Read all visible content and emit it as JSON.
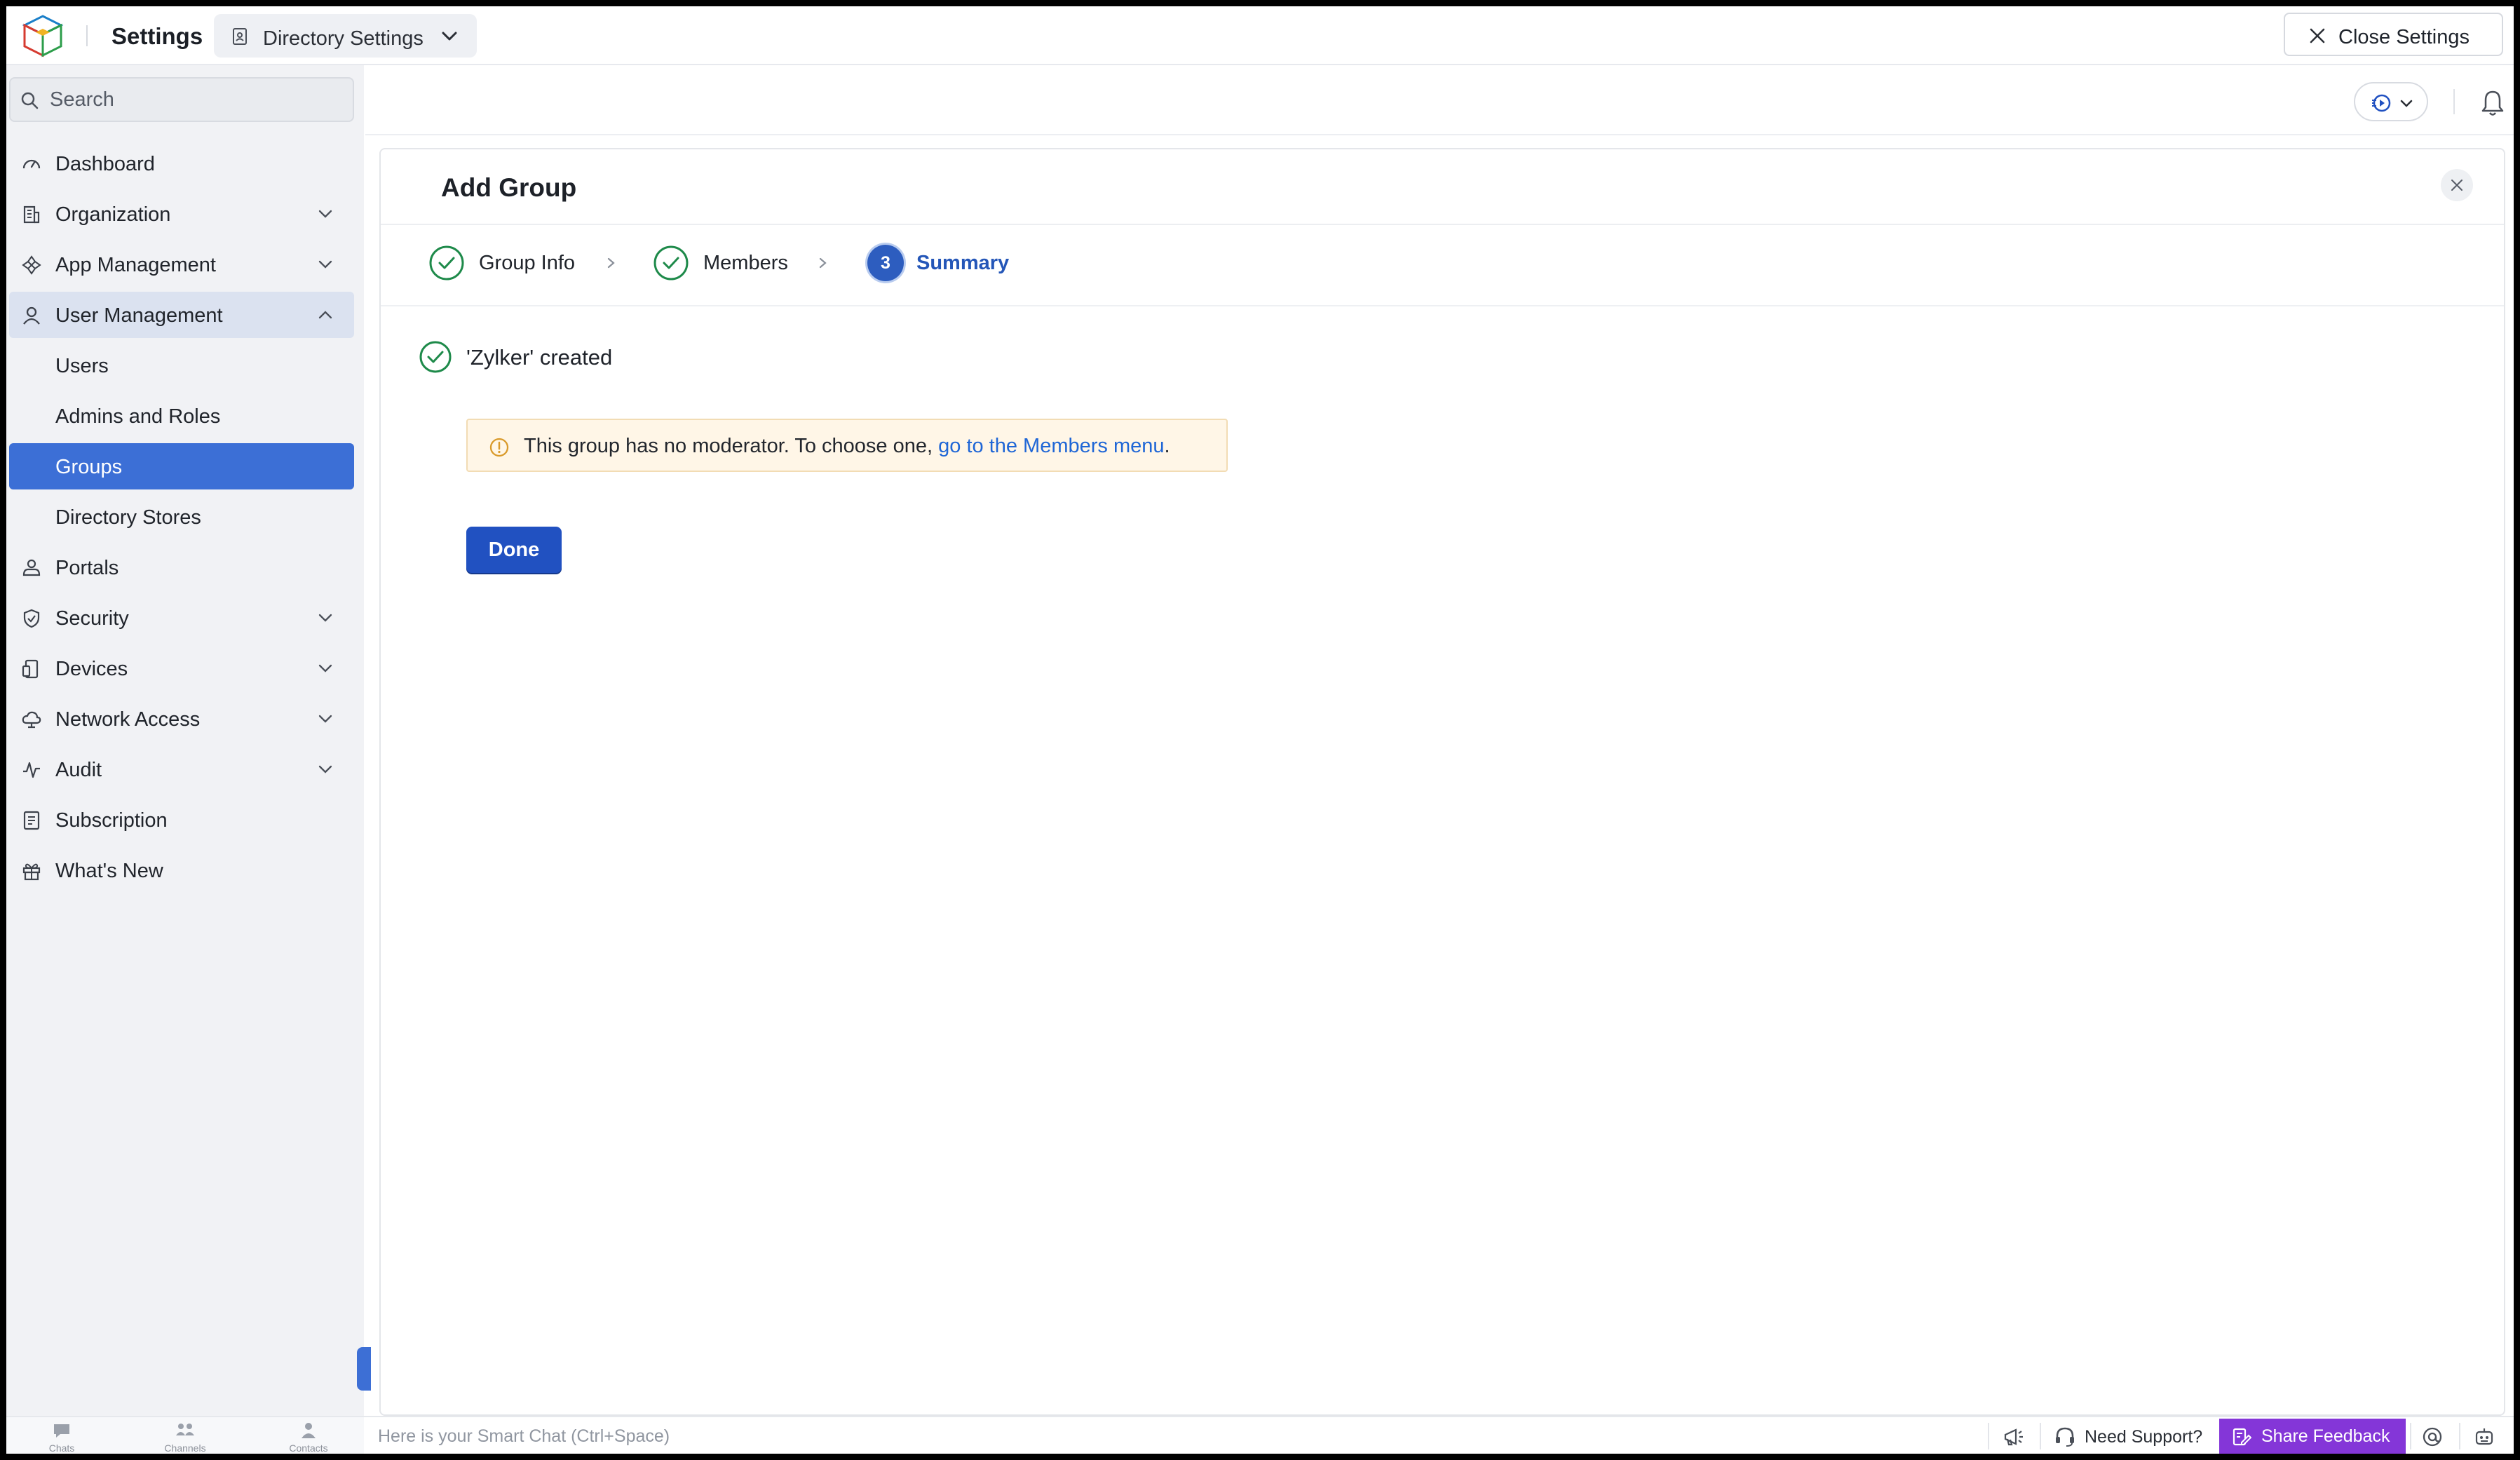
{
  "topbar": {
    "title": "Settings",
    "directory_dropdown": "Directory Settings",
    "close_settings": "Close Settings"
  },
  "sidebar": {
    "search_placeholder": "Search",
    "items": [
      {
        "label": "Dashboard",
        "icon": "dashboard-icon"
      },
      {
        "label": "Organization",
        "icon": "building-icon",
        "has_children": true
      },
      {
        "label": "App Management",
        "icon": "apps-icon",
        "has_children": true
      },
      {
        "label": "User Management",
        "icon": "user-icon",
        "has_children": true,
        "expanded": true
      },
      {
        "label": "Users",
        "sub": true
      },
      {
        "label": "Admins and Roles",
        "sub": true
      },
      {
        "label": "Groups",
        "sub": true,
        "active": true
      },
      {
        "label": "Directory Stores",
        "sub": true
      },
      {
        "label": "Portals",
        "icon": "portal-icon"
      },
      {
        "label": "Security",
        "icon": "shield-icon",
        "has_children": true
      },
      {
        "label": "Devices",
        "icon": "devices-icon",
        "has_children": true
      },
      {
        "label": "Network Access",
        "icon": "cloud-icon",
        "has_children": true
      },
      {
        "label": "Audit",
        "icon": "pulse-icon",
        "has_children": true
      },
      {
        "label": "Subscription",
        "icon": "receipt-icon"
      },
      {
        "label": "What's New",
        "icon": "gift-icon"
      }
    ]
  },
  "panel": {
    "title": "Add Group",
    "steps": [
      {
        "label": "Group Info",
        "state": "done"
      },
      {
        "label": "Members",
        "state": "done"
      },
      {
        "label": "Summary",
        "state": "active",
        "number": "3"
      }
    ],
    "created_message": "'Zylker' created",
    "alert_text": "This group has no moderator. To choose one, ",
    "alert_link": "go to the Members menu",
    "alert_end": ".",
    "done_button": "Done"
  },
  "bottombar": {
    "tabs": [
      "Chats",
      "Channels",
      "Contacts"
    ],
    "smart_chat_placeholder": "Here is your Smart Chat (Ctrl+Space)",
    "need_support": "Need Support?",
    "share_feedback": "Share Feedback"
  },
  "colors": {
    "accent": "#2151c1",
    "active_nav": "#3c6fd6",
    "success": "#1e8a4a",
    "warning": "#d99a2b",
    "feedback": "#8436d8"
  }
}
